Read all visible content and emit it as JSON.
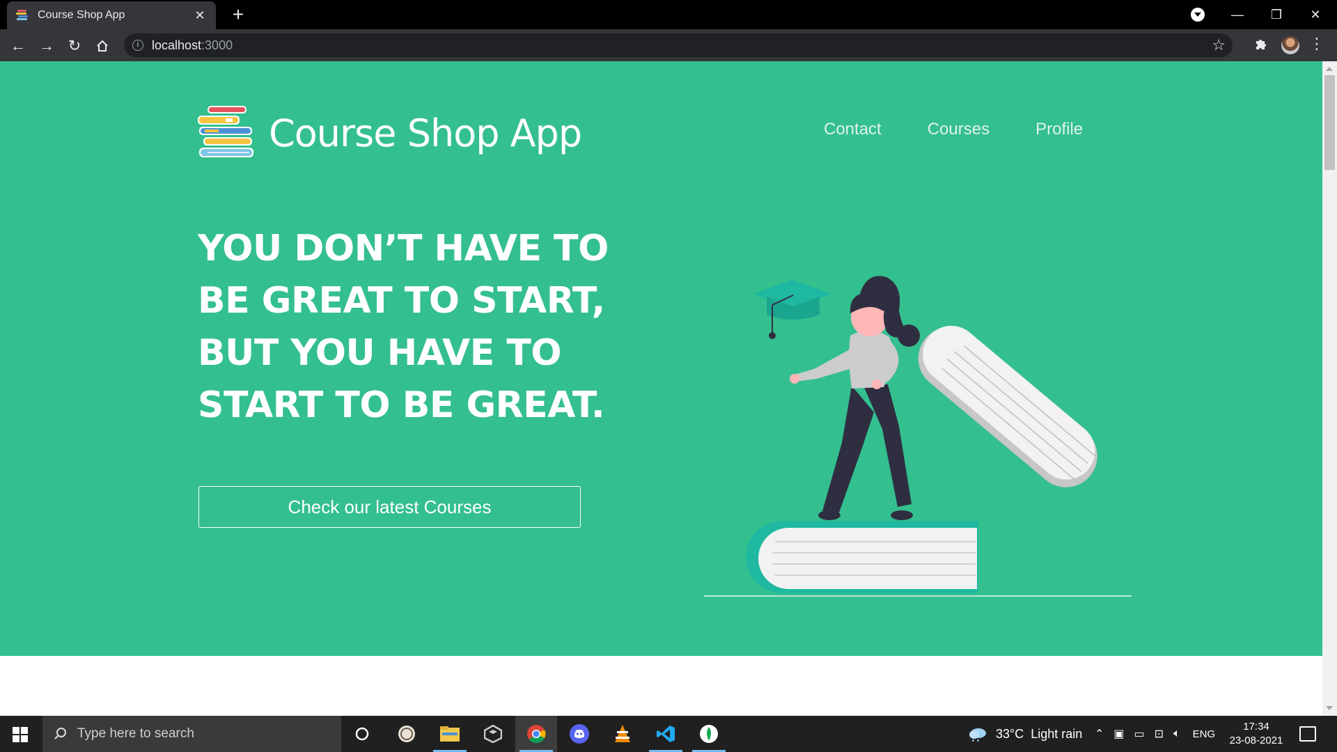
{
  "browser": {
    "tab_title": "Course Shop App",
    "tab_close": "✕",
    "new_tab": "+",
    "url_host": "localhost",
    "url_port": ":3000",
    "window_controls": {
      "minimize": "—",
      "restore": "❐",
      "close": "✕"
    }
  },
  "header": {
    "brand_name": "Course Shop App",
    "nav": [
      {
        "label": "Contact"
      },
      {
        "label": "Courses"
      },
      {
        "label": "Profile"
      }
    ]
  },
  "hero": {
    "headline_lines": [
      "YOU DON’T HAVE TO",
      "BE GREAT TO START,",
      "BUT YOU HAVE TO",
      "START TO BE GREAT."
    ],
    "cta_label": "Check our latest Courses"
  },
  "colors": {
    "hero_bg": "#34bf8f",
    "accent_teal": "#1fb8a0",
    "figure_dark": "#2f2e41",
    "book_white": "#f2f2f2"
  },
  "taskbar": {
    "search_placeholder": "Type here to search",
    "apps": [
      "cortana-icon",
      "app-icon",
      "file-explorer-icon",
      "unity-icon",
      "chrome-icon",
      "discord-icon",
      "vlc-icon",
      "vscode-icon",
      "mongodb-compass-icon"
    ],
    "weather_temp": "33°C",
    "weather_text": "Light rain",
    "language": "ENG",
    "time": "17:34",
    "date": "23-08-2021"
  }
}
